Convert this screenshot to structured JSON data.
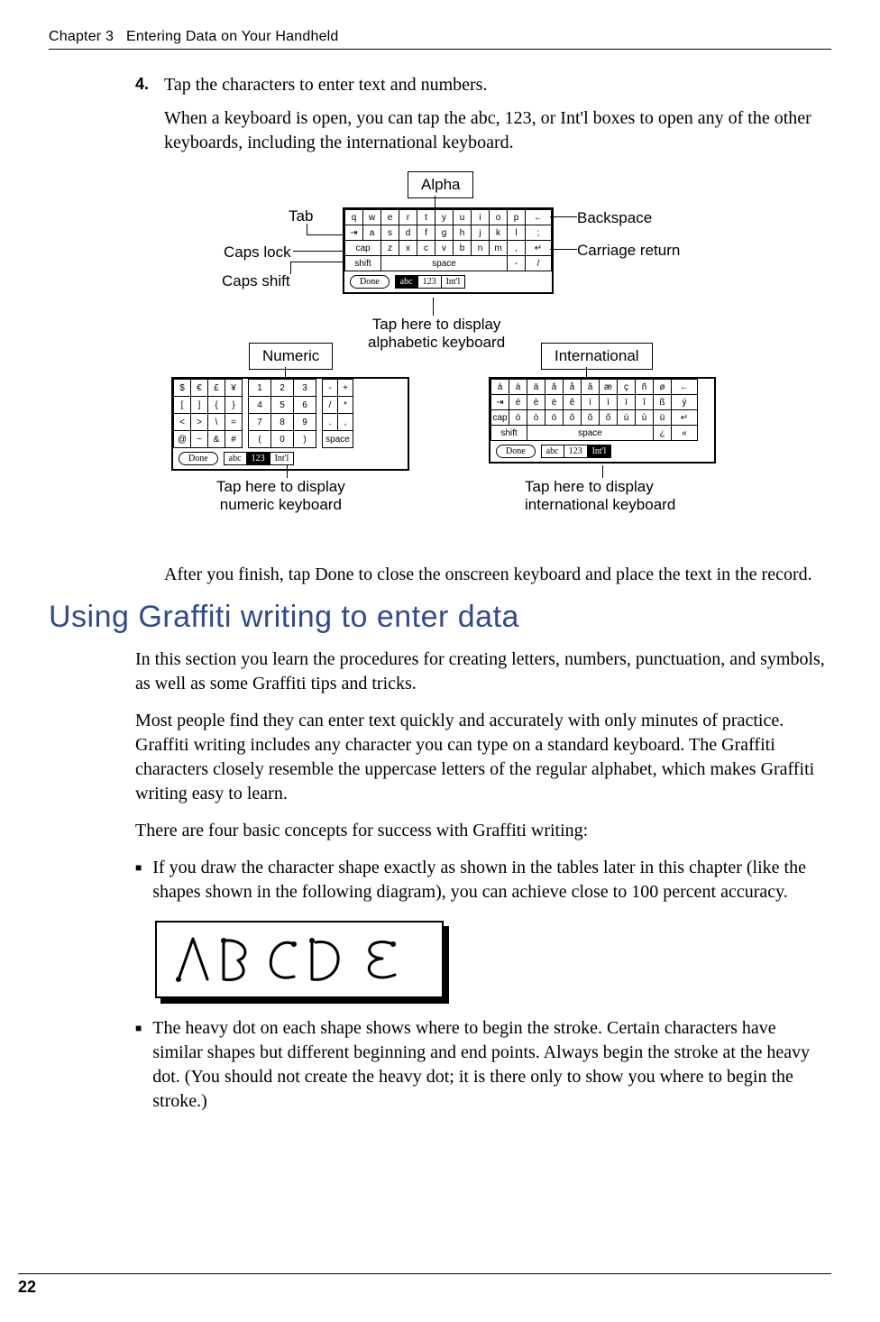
{
  "header": {
    "chapter": "Chapter 3",
    "title": "Entering Data on Your Handheld"
  },
  "step": {
    "number": "4.",
    "text": "Tap the characters to enter text and numbers."
  },
  "para1": "When a keyboard is open, you can tap the abc, 123, or Int'l boxes to open any of the other keyboards, including the international keyboard.",
  "diagram": {
    "alpha_label": "Alpha",
    "numeric_label": "Numeric",
    "international_label": "International",
    "tab": "Tab",
    "caps_lock": "Caps lock",
    "caps_shift": "Caps shift",
    "backspace": "Backspace",
    "carriage_return": "Carriage return",
    "tap_alpha": "Tap here to display\nalphabetic keyboard",
    "tap_numeric": "Tap here to display\nnumeric keyboard",
    "tap_intl": "Tap here to display\ninternational keyboard",
    "alpha_rows": [
      [
        "q",
        "w",
        "e",
        "r",
        "t",
        "y",
        "u",
        "i",
        "o",
        "p",
        "←"
      ],
      [
        "⇥",
        "a",
        "s",
        "d",
        "f",
        "g",
        "h",
        "j",
        "k",
        "l",
        ";",
        "'"
      ],
      [
        "cap",
        "z",
        "x",
        "c",
        "v",
        "b",
        "n",
        "m",
        ",",
        ".",
        "↵"
      ],
      [
        "shift",
        "space",
        "-",
        "/"
      ]
    ],
    "numeric_left": [
      [
        "$",
        "€",
        "£",
        "¥"
      ],
      [
        "[",
        "]",
        "{",
        "}"
      ],
      [
        "<",
        ">",
        "\\",
        "="
      ],
      [
        "@",
        "~",
        "&",
        "#"
      ]
    ],
    "numeric_mid": [
      [
        "1",
        "2",
        "3"
      ],
      [
        "4",
        "5",
        "6"
      ],
      [
        "7",
        "8",
        "9"
      ],
      [
        "(",
        "0",
        ")"
      ]
    ],
    "numeric_right": [
      [
        "-",
        "+"
      ],
      [
        "/",
        "*",
        ":",
        "⇥"
      ],
      [
        ".",
        ","
      ],
      [
        "space",
        "%"
      ]
    ],
    "intl_rows": [
      [
        "á",
        "à",
        "ä",
        "â",
        "å",
        "ã",
        "æ",
        "ç",
        "ñ",
        "ø",
        "←"
      ],
      [
        "⇥",
        "é",
        "è",
        "ë",
        "ê",
        "í",
        "ì",
        "ï",
        "î",
        "ß",
        "ý",
        "ÿ"
      ],
      [
        "cap",
        "ó",
        "ò",
        "ö",
        "ô",
        "õ",
        "ő",
        "ú",
        "ù",
        "ü",
        "û",
        "↵"
      ],
      [
        "shift",
        "space",
        "¿",
        "«"
      ]
    ],
    "done": "Done",
    "toggle": {
      "abc": "abc",
      "n123": "123",
      "intl": "Int'l"
    }
  },
  "para2": "After you finish, tap Done to close the onscreen keyboard and place the text in the record.",
  "h2": "Using Graffiti writing to enter data",
  "para3": "In this section you learn the procedures for creating letters, numbers, punctuation, and symbols, as well as some Graffiti tips and tricks.",
  "para4": "Most people find they can enter text quickly and accurately with only minutes of practice. Graffiti writing includes any character you can type on a standard keyboard. The Graffiti characters closely resemble the uppercase letters of the regular alphabet, which makes Graffiti writing easy to learn.",
  "para5": "There are four basic concepts for success with Graffiti writing:",
  "bullet1": "If you draw the character shape exactly as shown in the tables later in this chapter (like the shapes shown in the following diagram), you can achieve close to 100 percent accuracy.",
  "bullet2": "The heavy dot on each shape shows where to begin the stroke. Certain characters have similar shapes but different beginning and end points. Always begin the stroke at the heavy dot. (You should not create the heavy dot; it is there only to show you where to begin the stroke.)",
  "footer": {
    "page": "22"
  }
}
